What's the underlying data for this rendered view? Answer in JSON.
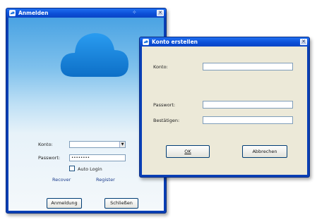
{
  "login_window": {
    "title": "Anmelden",
    "close_glyph": "✕",
    "konto_label": "Konto:",
    "konto_value": "",
    "passwort_label": "Passwort:",
    "passwort_value": "••••••••",
    "auto_login_label": "Auto Login",
    "auto_login_checked": false,
    "recover_link": "Recover",
    "register_link": "Register",
    "anmeldung_button": "Anmeldung",
    "schliessen_button": "Schließen",
    "icons": [
      "app-icon",
      "cloud-logo",
      "close-icon",
      "dropdown-arrow-icon"
    ]
  },
  "konto_window": {
    "title": "Konto erstellen",
    "close_glyph": "✕",
    "konto_label": "Konto:",
    "passwort_label": "Passwort:",
    "bestaetigen_label": "Bestätigen:",
    "ok_button": "OK",
    "abbrechen_button": "Abbrechen"
  },
  "colors": {
    "titlebar": "#0b4ed6",
    "dialog_bg": "#ece9d8",
    "sky_top": "#4aa3e3",
    "cloud": "#1a8be0"
  }
}
